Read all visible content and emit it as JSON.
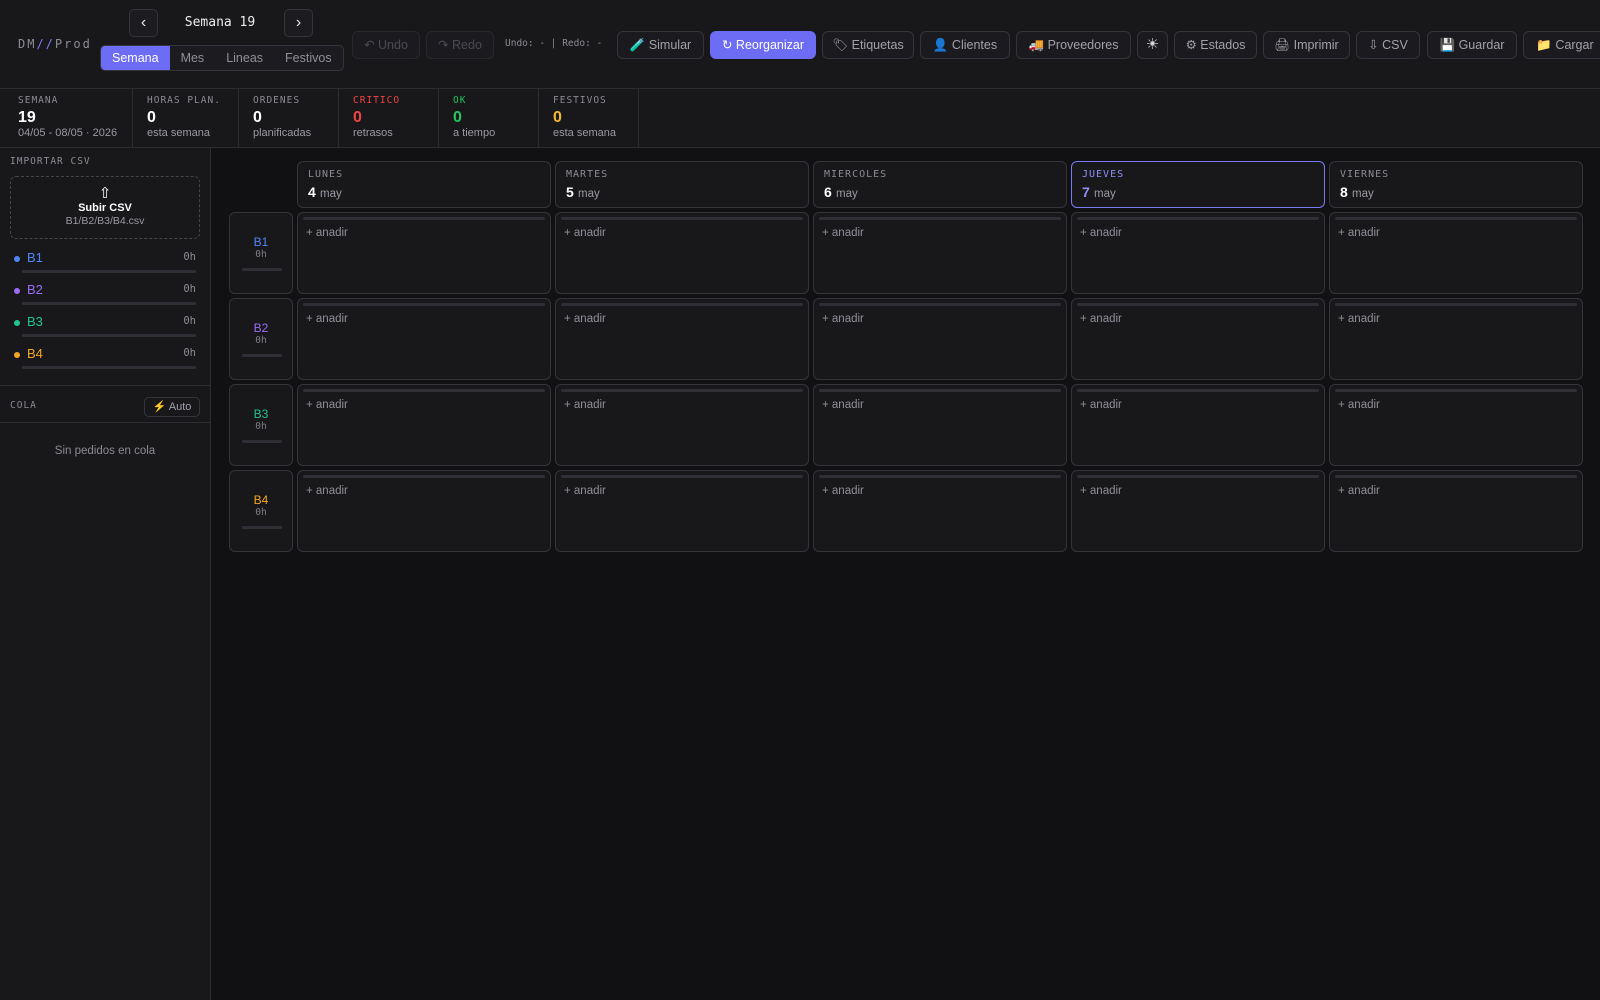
{
  "app": {
    "logo_prefix": "DM",
    "logo_slashes": "//",
    "logo_suffix": "Prod"
  },
  "week_nav": {
    "prev_icon": "‹",
    "title": "Semana 19",
    "next_icon": "›"
  },
  "view_tabs": [
    {
      "label": "Semana",
      "active": true
    },
    {
      "label": "Mes",
      "active": false
    },
    {
      "label": "Lineas",
      "active": false
    },
    {
      "label": "Festivos",
      "active": false
    }
  ],
  "toolbar": {
    "undo": "↶ Undo",
    "redo": "↷ Redo",
    "undo_status": "Undo: - | Redo: -",
    "simular": "🧪 Simular",
    "reorganizar": "↻ Reorganizar",
    "etiquetas": "🏷 Etiquetas",
    "clientes": "👤 Clientes",
    "proveedores": "🚚 Proveedores",
    "theme_icon": "☀",
    "estados": "⚙ Estados",
    "imprimir": "🖨 Imprimir",
    "csv": "⇩ CSV",
    "guardar": "💾 Guardar",
    "cargar": "📁 Cargar"
  },
  "stats": [
    {
      "label": "SEMANA",
      "value": "19",
      "sub": "04/05 - 08/05 · 2026",
      "color": "#ffffff",
      "label_color": "#8b8b93"
    },
    {
      "label": "HORAS PLAN.",
      "value": "0",
      "sub": "esta semana",
      "color": "#ffffff",
      "label_color": "#8b8b93"
    },
    {
      "label": "ORDENES",
      "value": "0",
      "sub": "planificadas",
      "color": "#ffffff",
      "label_color": "#8b8b93"
    },
    {
      "label": "CRITICO",
      "value": "0",
      "sub": "retrasos",
      "color": "#ef4444",
      "label_color": "#ef4444"
    },
    {
      "label": "OK",
      "value": "0",
      "sub": "a tiempo",
      "color": "#22c55e",
      "label_color": "#22c55e"
    },
    {
      "label": "FESTIVOS",
      "value": "0",
      "sub": "esta semana",
      "color": "#f5b82e",
      "label_color": "#8b8b93"
    }
  ],
  "sidebar": {
    "import_title": "IMPORTAR CSV",
    "upload_icon": "⇧",
    "upload_title": "Subir CSV",
    "upload_sub": "B1/B2/B3/B4.csv",
    "lines": [
      {
        "name": "B1",
        "hours": "0h",
        "color": "#4f86f7"
      },
      {
        "name": "B2",
        "hours": "0h",
        "color": "#9b6cf5"
      },
      {
        "name": "B3",
        "hours": "0h",
        "color": "#22c58b"
      },
      {
        "name": "B4",
        "hours": "0h",
        "color": "#f5a623"
      }
    ],
    "queue_title": "COLA",
    "auto_button": "⚡ Auto",
    "empty_queue": "Sin pedidos en cola"
  },
  "planner": {
    "days": [
      {
        "name": "LUNES",
        "num": "4",
        "month": "may",
        "today": false
      },
      {
        "name": "MARTES",
        "num": "5",
        "month": "may",
        "today": false
      },
      {
        "name": "MIERCOLES",
        "num": "6",
        "month": "may",
        "today": false
      },
      {
        "name": "JUEVES",
        "num": "7",
        "month": "may",
        "today": true
      },
      {
        "name": "VIERNES",
        "num": "8",
        "month": "may",
        "today": false
      }
    ],
    "rows": [
      {
        "name": "B1",
        "hours": "0h",
        "color": "#4f86f7"
      },
      {
        "name": "B2",
        "hours": "0h",
        "color": "#9b6cf5"
      },
      {
        "name": "B3",
        "hours": "0h",
        "color": "#22c58b"
      },
      {
        "name": "B4",
        "hours": "0h",
        "color": "#f5a623"
      }
    ],
    "add_label": "+ anadir"
  }
}
